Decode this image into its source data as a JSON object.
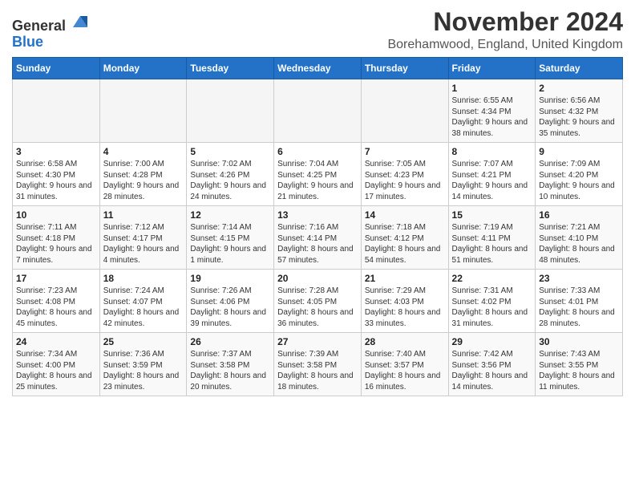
{
  "header": {
    "logo_general": "General",
    "logo_blue": "Blue",
    "title": "November 2024",
    "subtitle": "Borehamwood, England, United Kingdom"
  },
  "weekdays": [
    "Sunday",
    "Monday",
    "Tuesday",
    "Wednesday",
    "Thursday",
    "Friday",
    "Saturday"
  ],
  "weeks": [
    [
      {
        "day": "",
        "info": ""
      },
      {
        "day": "",
        "info": ""
      },
      {
        "day": "",
        "info": ""
      },
      {
        "day": "",
        "info": ""
      },
      {
        "day": "",
        "info": ""
      },
      {
        "day": "1",
        "info": "Sunrise: 6:55 AM\nSunset: 4:34 PM\nDaylight: 9 hours and 38 minutes."
      },
      {
        "day": "2",
        "info": "Sunrise: 6:56 AM\nSunset: 4:32 PM\nDaylight: 9 hours and 35 minutes."
      }
    ],
    [
      {
        "day": "3",
        "info": "Sunrise: 6:58 AM\nSunset: 4:30 PM\nDaylight: 9 hours and 31 minutes."
      },
      {
        "day": "4",
        "info": "Sunrise: 7:00 AM\nSunset: 4:28 PM\nDaylight: 9 hours and 28 minutes."
      },
      {
        "day": "5",
        "info": "Sunrise: 7:02 AM\nSunset: 4:26 PM\nDaylight: 9 hours and 24 minutes."
      },
      {
        "day": "6",
        "info": "Sunrise: 7:04 AM\nSunset: 4:25 PM\nDaylight: 9 hours and 21 minutes."
      },
      {
        "day": "7",
        "info": "Sunrise: 7:05 AM\nSunset: 4:23 PM\nDaylight: 9 hours and 17 minutes."
      },
      {
        "day": "8",
        "info": "Sunrise: 7:07 AM\nSunset: 4:21 PM\nDaylight: 9 hours and 14 minutes."
      },
      {
        "day": "9",
        "info": "Sunrise: 7:09 AM\nSunset: 4:20 PM\nDaylight: 9 hours and 10 minutes."
      }
    ],
    [
      {
        "day": "10",
        "info": "Sunrise: 7:11 AM\nSunset: 4:18 PM\nDaylight: 9 hours and 7 minutes."
      },
      {
        "day": "11",
        "info": "Sunrise: 7:12 AM\nSunset: 4:17 PM\nDaylight: 9 hours and 4 minutes."
      },
      {
        "day": "12",
        "info": "Sunrise: 7:14 AM\nSunset: 4:15 PM\nDaylight: 9 hours and 1 minute."
      },
      {
        "day": "13",
        "info": "Sunrise: 7:16 AM\nSunset: 4:14 PM\nDaylight: 8 hours and 57 minutes."
      },
      {
        "day": "14",
        "info": "Sunrise: 7:18 AM\nSunset: 4:12 PM\nDaylight: 8 hours and 54 minutes."
      },
      {
        "day": "15",
        "info": "Sunrise: 7:19 AM\nSunset: 4:11 PM\nDaylight: 8 hours and 51 minutes."
      },
      {
        "day": "16",
        "info": "Sunrise: 7:21 AM\nSunset: 4:10 PM\nDaylight: 8 hours and 48 minutes."
      }
    ],
    [
      {
        "day": "17",
        "info": "Sunrise: 7:23 AM\nSunset: 4:08 PM\nDaylight: 8 hours and 45 minutes."
      },
      {
        "day": "18",
        "info": "Sunrise: 7:24 AM\nSunset: 4:07 PM\nDaylight: 8 hours and 42 minutes."
      },
      {
        "day": "19",
        "info": "Sunrise: 7:26 AM\nSunset: 4:06 PM\nDaylight: 8 hours and 39 minutes."
      },
      {
        "day": "20",
        "info": "Sunrise: 7:28 AM\nSunset: 4:05 PM\nDaylight: 8 hours and 36 minutes."
      },
      {
        "day": "21",
        "info": "Sunrise: 7:29 AM\nSunset: 4:03 PM\nDaylight: 8 hours and 33 minutes."
      },
      {
        "day": "22",
        "info": "Sunrise: 7:31 AM\nSunset: 4:02 PM\nDaylight: 8 hours and 31 minutes."
      },
      {
        "day": "23",
        "info": "Sunrise: 7:33 AM\nSunset: 4:01 PM\nDaylight: 8 hours and 28 minutes."
      }
    ],
    [
      {
        "day": "24",
        "info": "Sunrise: 7:34 AM\nSunset: 4:00 PM\nDaylight: 8 hours and 25 minutes."
      },
      {
        "day": "25",
        "info": "Sunrise: 7:36 AM\nSunset: 3:59 PM\nDaylight: 8 hours and 23 minutes."
      },
      {
        "day": "26",
        "info": "Sunrise: 7:37 AM\nSunset: 3:58 PM\nDaylight: 8 hours and 20 minutes."
      },
      {
        "day": "27",
        "info": "Sunrise: 7:39 AM\nSunset: 3:58 PM\nDaylight: 8 hours and 18 minutes."
      },
      {
        "day": "28",
        "info": "Sunrise: 7:40 AM\nSunset: 3:57 PM\nDaylight: 8 hours and 16 minutes."
      },
      {
        "day": "29",
        "info": "Sunrise: 7:42 AM\nSunset: 3:56 PM\nDaylight: 8 hours and 14 minutes."
      },
      {
        "day": "30",
        "info": "Sunrise: 7:43 AM\nSunset: 3:55 PM\nDaylight: 8 hours and 11 minutes."
      }
    ]
  ]
}
